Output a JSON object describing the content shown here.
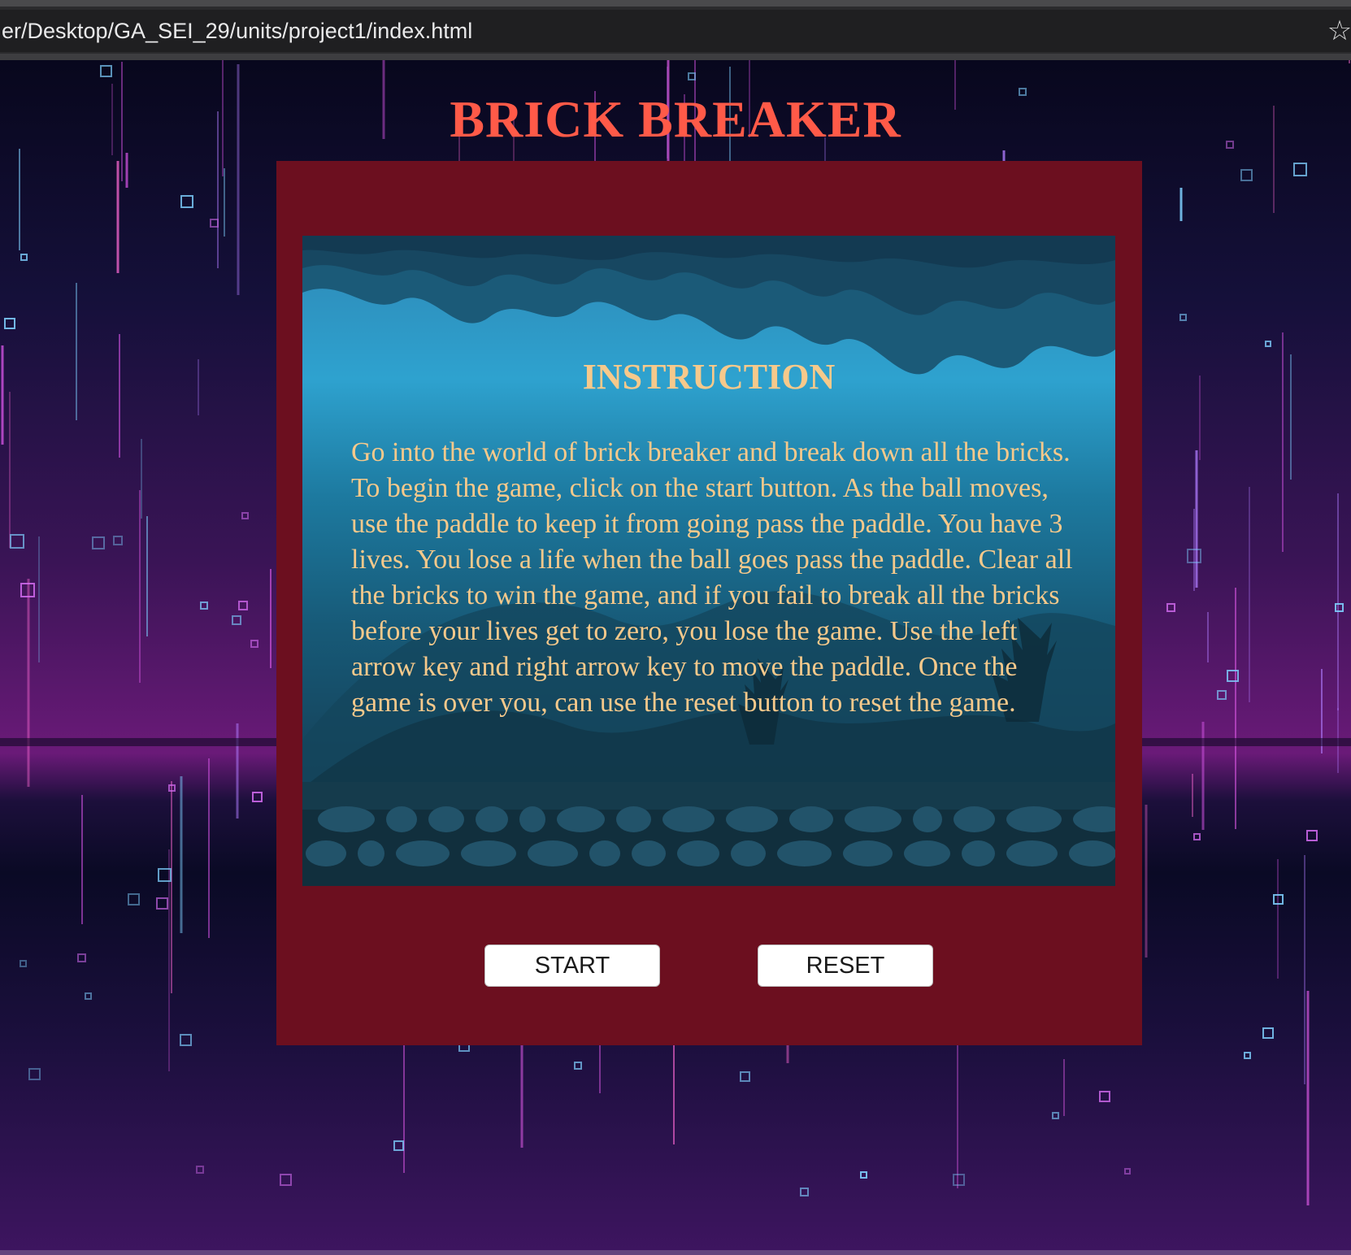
{
  "browser": {
    "url": "er/Desktop/GA_SEI_29/units/project1/index.html",
    "bookmark_icon": "star-icon"
  },
  "game": {
    "title": "BRICK BREAKER",
    "instruction_title": "INSTRUCTION",
    "instruction_text": "Go into the world of brick breaker and break down all the bricks. To begin the game, click on the start button. As the ball moves, use the paddle to keep it from going pass the paddle. You have 3 lives. You lose a life when the ball goes pass the paddle. Clear all the bricks to win the game, and if you fail to break all the bricks before your lives get to zero, you lose the game. Use the left arrow key and right arrow key to move the paddle. Once the game is over you, can use the reset button to reset the game.",
    "start_label": "START",
    "reset_label": "RESET"
  },
  "colors": {
    "title": "#ff5a48",
    "panel": "#6c0f1f",
    "instruction_text": "#f6c98b",
    "button_bg": "#ffffff"
  }
}
